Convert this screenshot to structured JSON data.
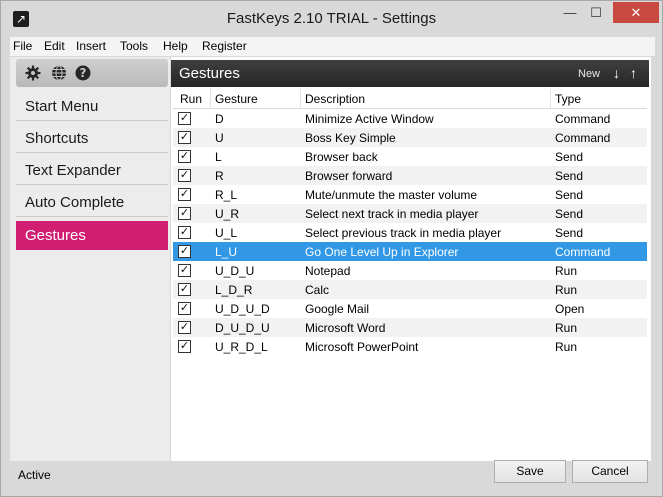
{
  "window": {
    "title": "FastKeys 2.10 TRIAL - Settings",
    "minimize": "—",
    "maximize": "☐",
    "close": "✕"
  },
  "menu": [
    "File",
    "Edit",
    "Insert",
    "Tools",
    "Help",
    "Register"
  ],
  "toolbar_icons": [
    "gear-icon",
    "globe-icon",
    "help-icon"
  ],
  "sidebar": {
    "items": [
      "Start Menu",
      "Shortcuts",
      "Text Expander",
      "Auto Complete",
      "Gestures"
    ],
    "active": "Gestures"
  },
  "panel": {
    "title": "Gestures",
    "new_label": "New",
    "down_arrow": "↓",
    "up_arrow": "↑"
  },
  "table": {
    "columns": [
      "Run",
      "Gesture",
      "Description",
      "Type"
    ],
    "rows": [
      {
        "run": true,
        "gesture": "D",
        "description": "Minimize Active Window",
        "type": "Command"
      },
      {
        "run": true,
        "gesture": "U",
        "description": "Boss Key Simple",
        "type": "Command"
      },
      {
        "run": true,
        "gesture": "L",
        "description": "Browser back",
        "type": "Send"
      },
      {
        "run": true,
        "gesture": "R",
        "description": "Browser forward",
        "type": "Send"
      },
      {
        "run": true,
        "gesture": "R_L",
        "description": "Mute/unmute the master volume",
        "type": "Send"
      },
      {
        "run": true,
        "gesture": "U_R",
        "description": "Select next track in media player",
        "type": "Send"
      },
      {
        "run": true,
        "gesture": "U_L",
        "description": "Select previous track in media player",
        "type": "Send"
      },
      {
        "run": true,
        "gesture": "L_U",
        "description": "Go One Level Up in Explorer",
        "type": "Command"
      },
      {
        "run": true,
        "gesture": "U_D_U",
        "description": "Notepad",
        "type": "Run"
      },
      {
        "run": true,
        "gesture": "L_D_R",
        "description": "Calc",
        "type": "Run"
      },
      {
        "run": true,
        "gesture": "U_D_U_D",
        "description": "Google Mail",
        "type": "Open"
      },
      {
        "run": true,
        "gesture": "D_U_D_U",
        "description": "Microsoft Word",
        "type": "Run"
      },
      {
        "run": true,
        "gesture": "U_R_D_L",
        "description": "Microsoft PowerPoint",
        "type": "Run"
      }
    ],
    "selected_index": 7
  },
  "status": "Active",
  "buttons": {
    "save": "Save",
    "cancel": "Cancel"
  },
  "colors": {
    "accent": "#d21e72",
    "selection": "#3298e6",
    "close": "#c7493f"
  }
}
